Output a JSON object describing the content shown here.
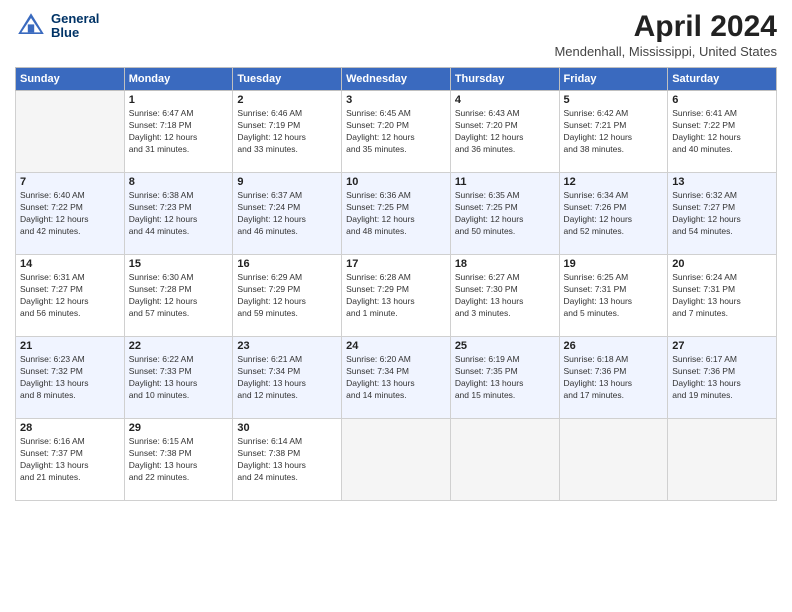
{
  "header": {
    "logo_line1": "General",
    "logo_line2": "Blue",
    "title": "April 2024",
    "location": "Mendenhall, Mississippi, United States"
  },
  "days_of_week": [
    "Sunday",
    "Monday",
    "Tuesday",
    "Wednesday",
    "Thursday",
    "Friday",
    "Saturday"
  ],
  "weeks": [
    [
      {
        "day": "",
        "info": ""
      },
      {
        "day": "1",
        "info": "Sunrise: 6:47 AM\nSunset: 7:18 PM\nDaylight: 12 hours\nand 31 minutes."
      },
      {
        "day": "2",
        "info": "Sunrise: 6:46 AM\nSunset: 7:19 PM\nDaylight: 12 hours\nand 33 minutes."
      },
      {
        "day": "3",
        "info": "Sunrise: 6:45 AM\nSunset: 7:20 PM\nDaylight: 12 hours\nand 35 minutes."
      },
      {
        "day": "4",
        "info": "Sunrise: 6:43 AM\nSunset: 7:20 PM\nDaylight: 12 hours\nand 36 minutes."
      },
      {
        "day": "5",
        "info": "Sunrise: 6:42 AM\nSunset: 7:21 PM\nDaylight: 12 hours\nand 38 minutes."
      },
      {
        "day": "6",
        "info": "Sunrise: 6:41 AM\nSunset: 7:22 PM\nDaylight: 12 hours\nand 40 minutes."
      }
    ],
    [
      {
        "day": "7",
        "info": "Sunrise: 6:40 AM\nSunset: 7:22 PM\nDaylight: 12 hours\nand 42 minutes."
      },
      {
        "day": "8",
        "info": "Sunrise: 6:38 AM\nSunset: 7:23 PM\nDaylight: 12 hours\nand 44 minutes."
      },
      {
        "day": "9",
        "info": "Sunrise: 6:37 AM\nSunset: 7:24 PM\nDaylight: 12 hours\nand 46 minutes."
      },
      {
        "day": "10",
        "info": "Sunrise: 6:36 AM\nSunset: 7:25 PM\nDaylight: 12 hours\nand 48 minutes."
      },
      {
        "day": "11",
        "info": "Sunrise: 6:35 AM\nSunset: 7:25 PM\nDaylight: 12 hours\nand 50 minutes."
      },
      {
        "day": "12",
        "info": "Sunrise: 6:34 AM\nSunset: 7:26 PM\nDaylight: 12 hours\nand 52 minutes."
      },
      {
        "day": "13",
        "info": "Sunrise: 6:32 AM\nSunset: 7:27 PM\nDaylight: 12 hours\nand 54 minutes."
      }
    ],
    [
      {
        "day": "14",
        "info": "Sunrise: 6:31 AM\nSunset: 7:27 PM\nDaylight: 12 hours\nand 56 minutes."
      },
      {
        "day": "15",
        "info": "Sunrise: 6:30 AM\nSunset: 7:28 PM\nDaylight: 12 hours\nand 57 minutes."
      },
      {
        "day": "16",
        "info": "Sunrise: 6:29 AM\nSunset: 7:29 PM\nDaylight: 12 hours\nand 59 minutes."
      },
      {
        "day": "17",
        "info": "Sunrise: 6:28 AM\nSunset: 7:29 PM\nDaylight: 13 hours\nand 1 minute."
      },
      {
        "day": "18",
        "info": "Sunrise: 6:27 AM\nSunset: 7:30 PM\nDaylight: 13 hours\nand 3 minutes."
      },
      {
        "day": "19",
        "info": "Sunrise: 6:25 AM\nSunset: 7:31 PM\nDaylight: 13 hours\nand 5 minutes."
      },
      {
        "day": "20",
        "info": "Sunrise: 6:24 AM\nSunset: 7:31 PM\nDaylight: 13 hours\nand 7 minutes."
      }
    ],
    [
      {
        "day": "21",
        "info": "Sunrise: 6:23 AM\nSunset: 7:32 PM\nDaylight: 13 hours\nand 8 minutes."
      },
      {
        "day": "22",
        "info": "Sunrise: 6:22 AM\nSunset: 7:33 PM\nDaylight: 13 hours\nand 10 minutes."
      },
      {
        "day": "23",
        "info": "Sunrise: 6:21 AM\nSunset: 7:34 PM\nDaylight: 13 hours\nand 12 minutes."
      },
      {
        "day": "24",
        "info": "Sunrise: 6:20 AM\nSunset: 7:34 PM\nDaylight: 13 hours\nand 14 minutes."
      },
      {
        "day": "25",
        "info": "Sunrise: 6:19 AM\nSunset: 7:35 PM\nDaylight: 13 hours\nand 15 minutes."
      },
      {
        "day": "26",
        "info": "Sunrise: 6:18 AM\nSunset: 7:36 PM\nDaylight: 13 hours\nand 17 minutes."
      },
      {
        "day": "27",
        "info": "Sunrise: 6:17 AM\nSunset: 7:36 PM\nDaylight: 13 hours\nand 19 minutes."
      }
    ],
    [
      {
        "day": "28",
        "info": "Sunrise: 6:16 AM\nSunset: 7:37 PM\nDaylight: 13 hours\nand 21 minutes."
      },
      {
        "day": "29",
        "info": "Sunrise: 6:15 AM\nSunset: 7:38 PM\nDaylight: 13 hours\nand 22 minutes."
      },
      {
        "day": "30",
        "info": "Sunrise: 6:14 AM\nSunset: 7:38 PM\nDaylight: 13 hours\nand 24 minutes."
      },
      {
        "day": "",
        "info": ""
      },
      {
        "day": "",
        "info": ""
      },
      {
        "day": "",
        "info": ""
      },
      {
        "day": "",
        "info": ""
      }
    ]
  ]
}
